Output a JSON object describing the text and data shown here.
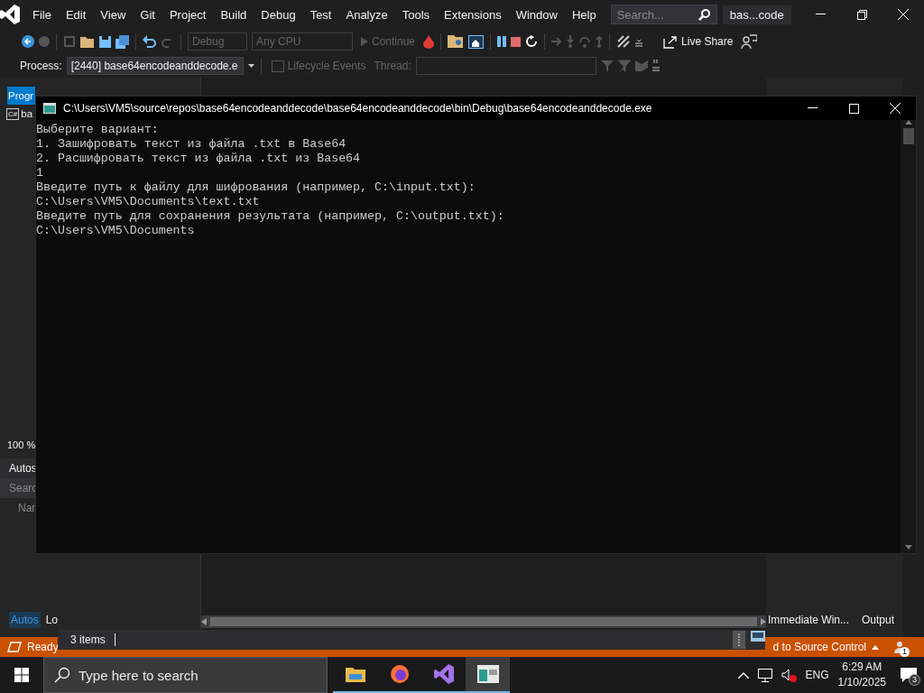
{
  "ide": {
    "menu": [
      "File",
      "Edit",
      "View",
      "Git",
      "Project",
      "Build",
      "Debug",
      "Test",
      "Analyze",
      "Tools",
      "Extensions",
      "Window",
      "Help"
    ],
    "search": {
      "placeholder": "Search..."
    },
    "solution_name": "bas...code",
    "toolbar": {
      "configuration": {
        "value": "Debug",
        "disabled": true
      },
      "platform": {
        "value": "Any CPU",
        "disabled": true
      },
      "continue": {
        "label": "Continue",
        "disabled": true
      },
      "live_share": "Live Share"
    },
    "debug_bar": {
      "process_label": "Process:",
      "process": "[2440] base64encodeanddecode.e",
      "lifecycle": {
        "label": "Lifecycle Events",
        "disabled": true
      },
      "thread_label": "Thread:"
    },
    "left_panel": {
      "tab": {
        "label": "Progr",
        "selected": true
      },
      "item_icon": "C#",
      "item": "ba",
      "zoom": "100 %",
      "autos_title": "Autos",
      "search_placeholder": "Searc",
      "column": "Nar",
      "tabs": [
        {
          "label": "Autos",
          "selected": true
        },
        {
          "label": "Lo",
          "selected": false
        }
      ]
    },
    "right_panel": {
      "tabs": [
        {
          "label": "Immediate Win...",
          "selected": false
        },
        {
          "label": "Output",
          "selected": false
        }
      ]
    },
    "items_bar": "3 items",
    "status_bar": {
      "state": "Ready",
      "source_control": "d to Source Control",
      "notifications": "1"
    }
  },
  "console": {
    "title": "C:\\Users\\VM5\\source\\repos\\base64encodeanddecode\\base64encodeanddecode\\bin\\Debug\\base64encodeanddecode.exe",
    "lines": [
      "Выберите вариант:",
      "1. Зашифровать текст из файла .txt в Base64",
      "2. Расшифровать текст из файла .txt из Base64",
      "1",
      "Введите путь к файлу для шифрования (например, C:\\input.txt):",
      "C:\\Users\\VM5\\Documents\\text.txt",
      "Введите путь для сохранения результата (например, C:\\output.txt):",
      "C:\\Users\\VM5\\Documents"
    ]
  },
  "taskbar": {
    "search": {
      "placeholder": "Type here to search"
    },
    "apps": [
      {
        "kind": "folder",
        "selected": false
      },
      {
        "kind": "browser",
        "selected": false
      },
      {
        "kind": "studio",
        "selected": false
      },
      {
        "kind": "console",
        "selected": true
      }
    ],
    "language": "ENG",
    "time": "6:29 AM",
    "date": "1/10/2025",
    "notifications": "3"
  }
}
